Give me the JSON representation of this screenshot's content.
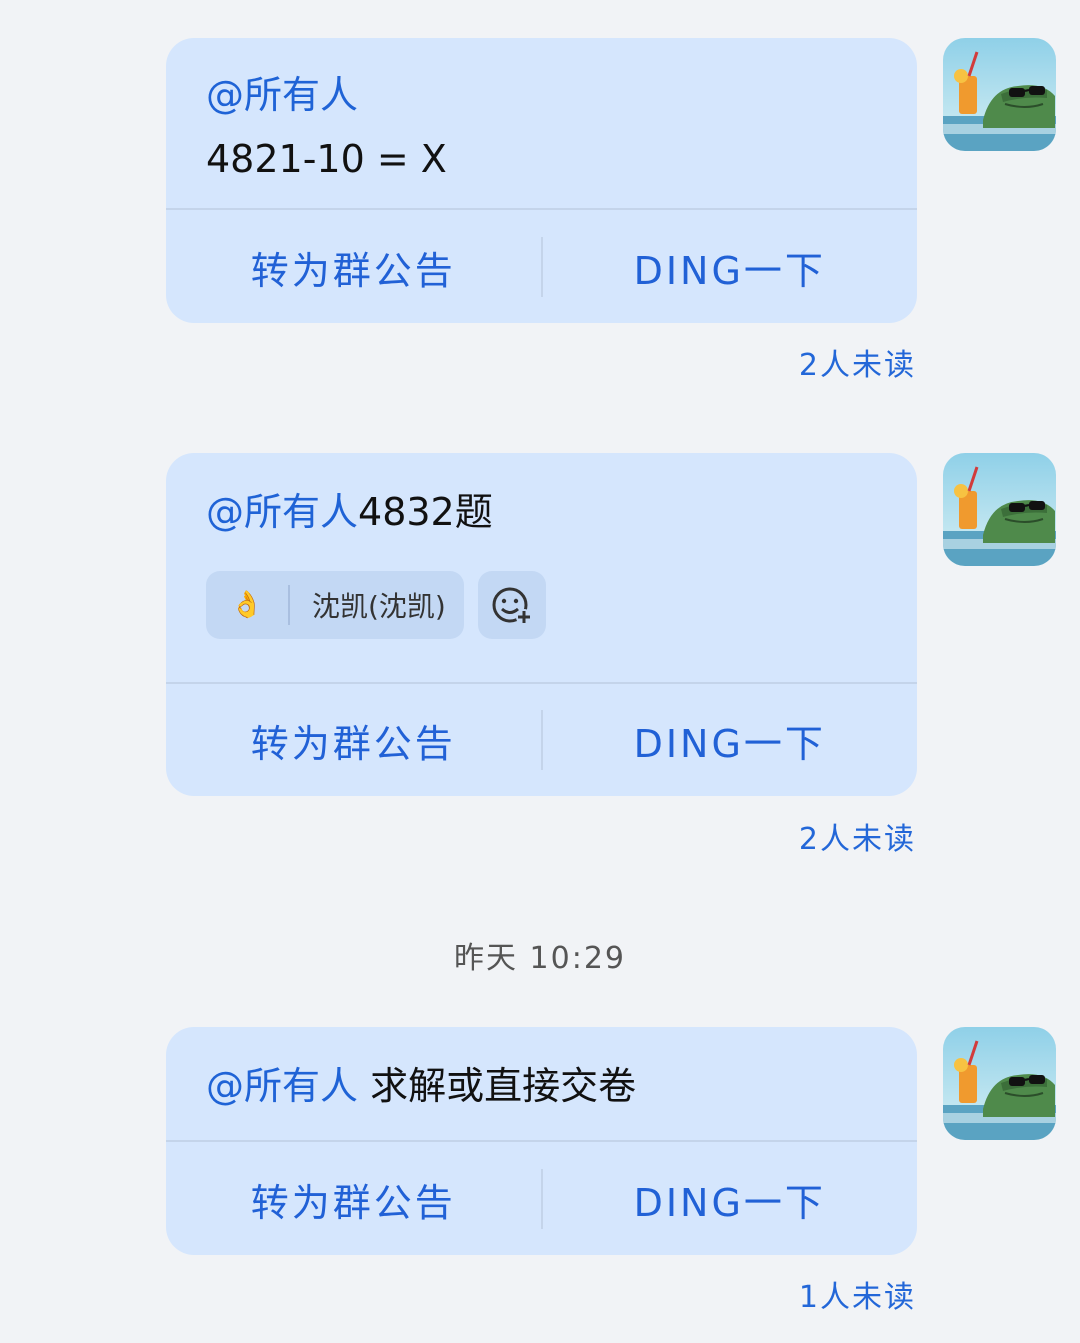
{
  "messages": [
    {
      "mention": "@所有人",
      "text": "",
      "line2": "4821-10 = X",
      "action_announce": "转为群公告",
      "action_ding": "DING一下",
      "unread": "2人未读"
    },
    {
      "mention": "@所有人",
      "text": "4832题",
      "reaction_emoji": "👌",
      "reaction_name": "沈凯(沈凯)",
      "action_announce": "转为群公告",
      "action_ding": "DING一下",
      "unread": "2人未读"
    },
    {
      "mention": "@所有人",
      "text": "求解或直接交卷",
      "action_announce": "转为群公告",
      "action_ding": "DING一下",
      "unread": "1人未读"
    }
  ],
  "time_separator": "昨天 10:29",
  "colors": {
    "bubble": "#d5e6fd",
    "accent": "#2161d6",
    "background": "#f1f3f6"
  },
  "icons": {
    "avatar": "crocodile-sunglasses-avatar",
    "add_reaction": "add-emoji-icon"
  }
}
